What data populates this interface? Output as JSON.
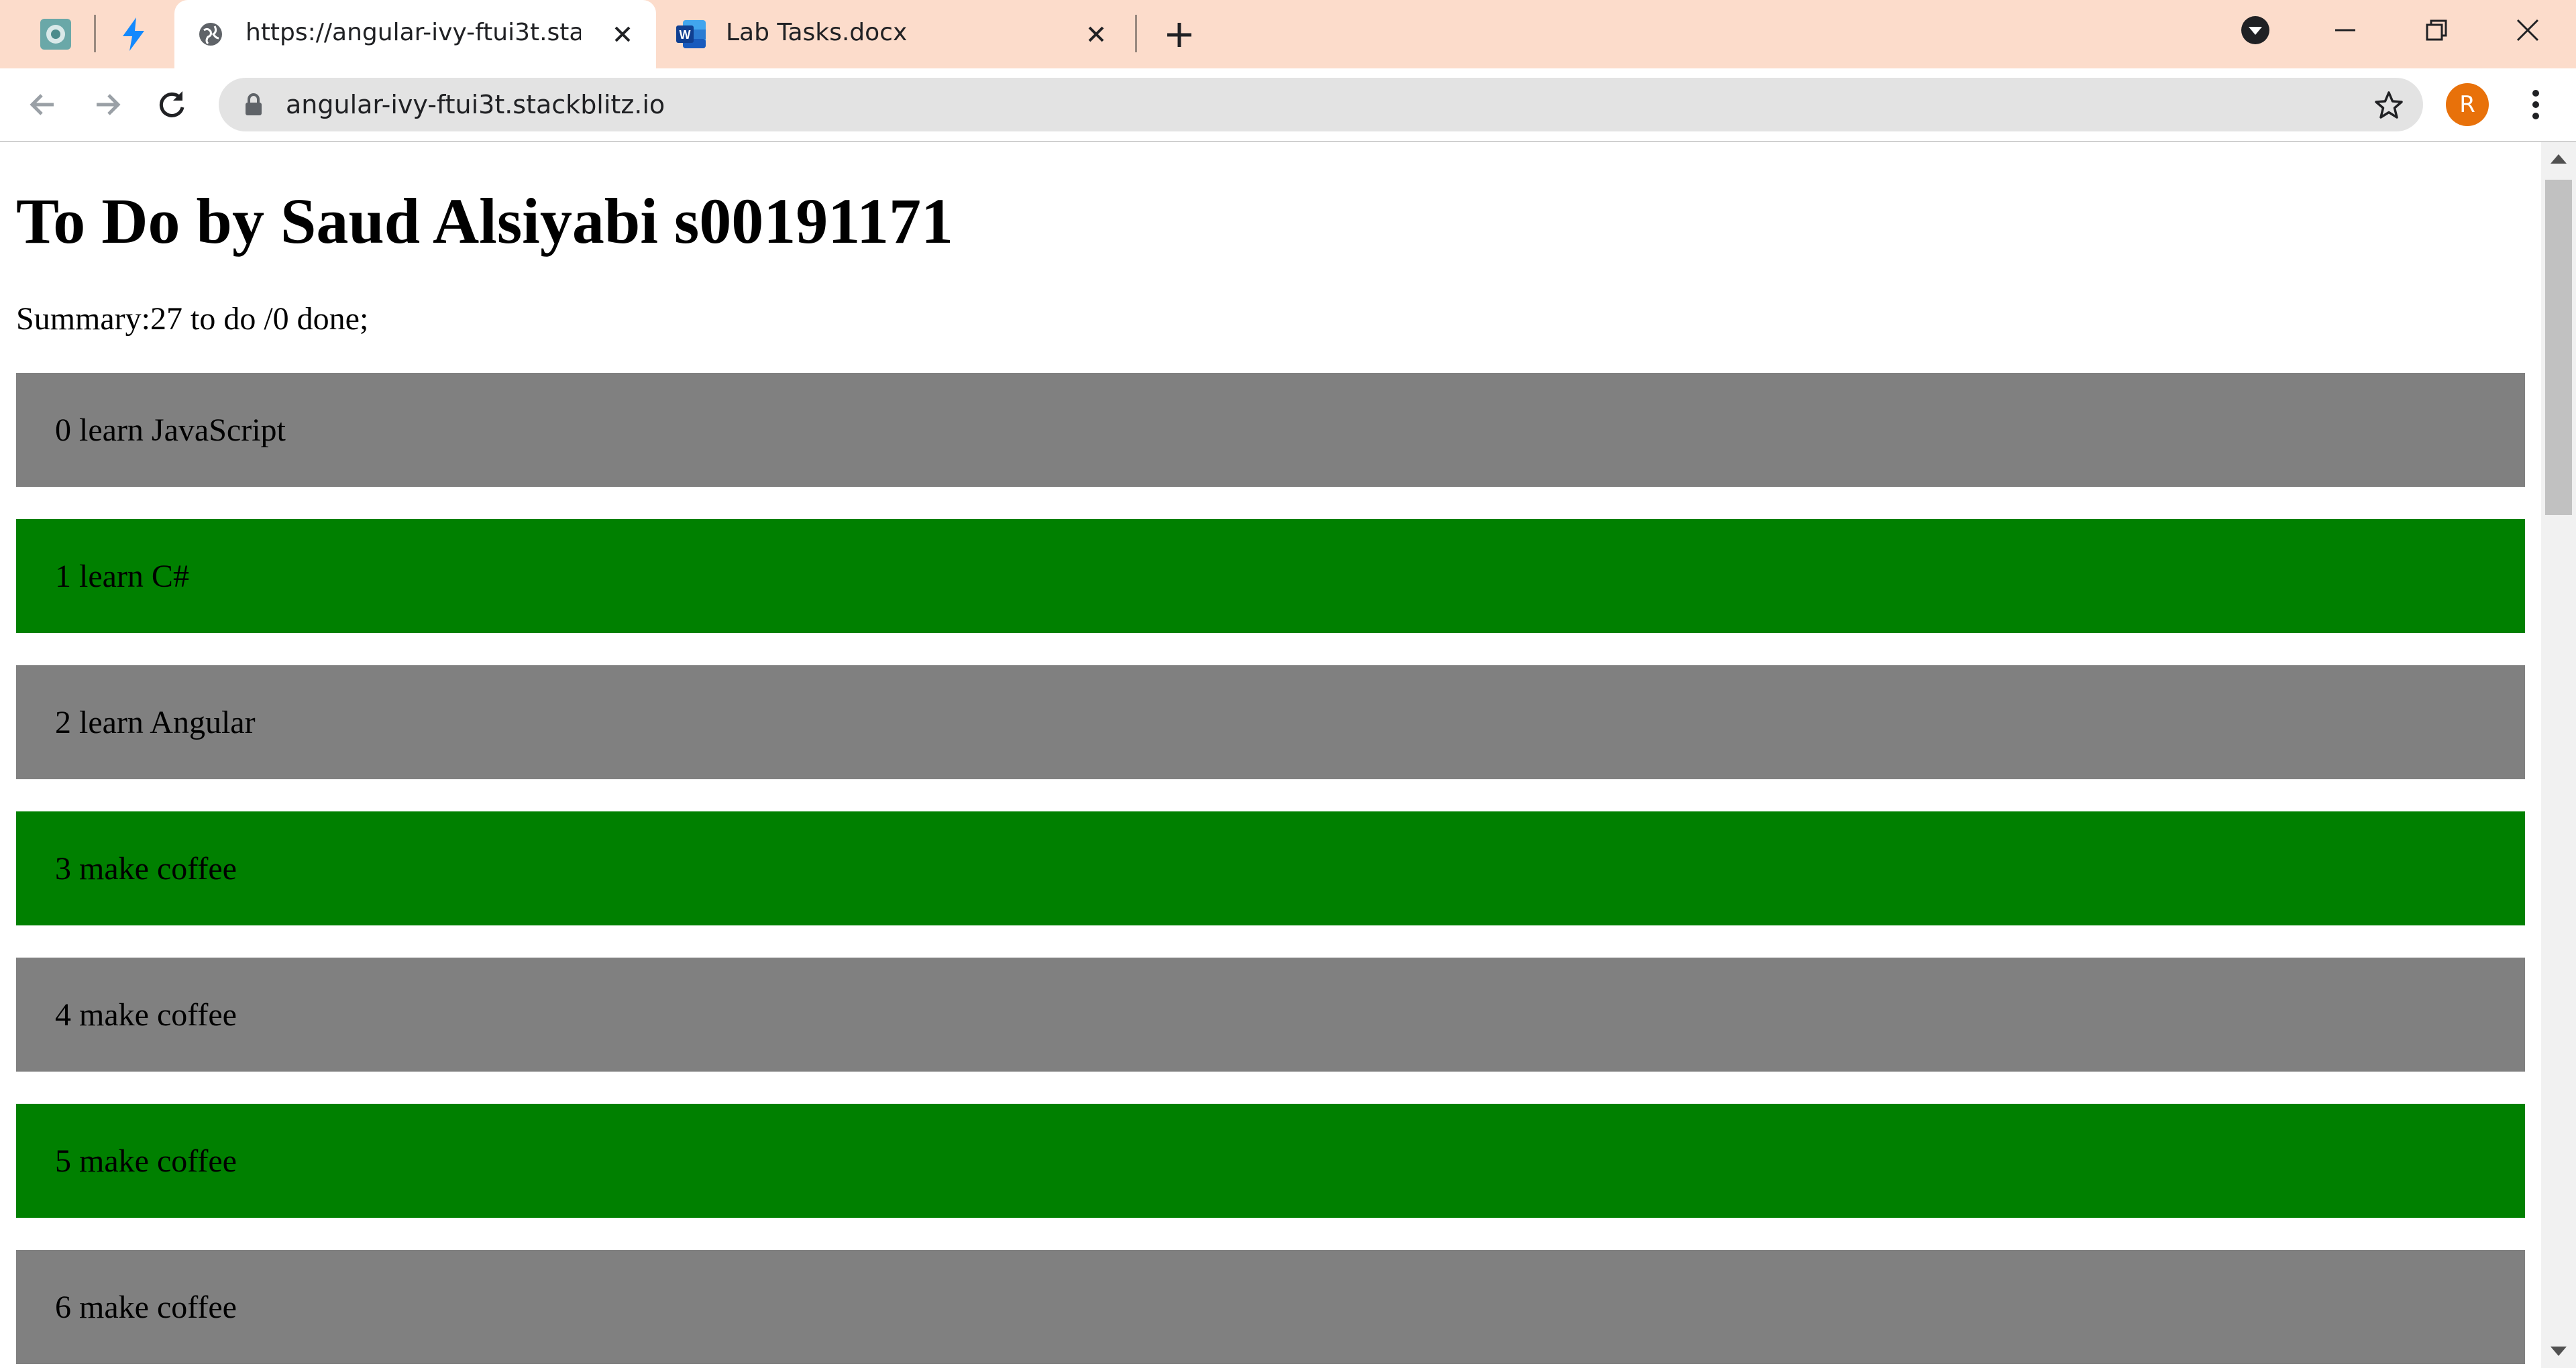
{
  "browser": {
    "tabs": [
      {
        "title": "https://angular-ivy-ftui3t.stackblitz.io",
        "active": true
      },
      {
        "title": "Lab Tasks.docx",
        "active": false
      }
    ],
    "address_bar": {
      "url": "angular-ivy-ftui3t.stackblitz.io"
    },
    "profile_initial": "R",
    "colors": {
      "tabstrip": "#fcdccb",
      "avatar": "#e8710a"
    }
  },
  "page": {
    "title": "To Do by Saud Alsiyabi s00191171",
    "summary": "Summary:27 to do /0 done;",
    "todos": [
      {
        "label": "0 learn JavaScript",
        "color": "gray"
      },
      {
        "label": "1 learn C#",
        "color": "green"
      },
      {
        "label": "2 learn Angular",
        "color": "gray"
      },
      {
        "label": "3 make coffee",
        "color": "green"
      },
      {
        "label": "4 make coffee",
        "color": "gray"
      },
      {
        "label": "5 make coffee",
        "color": "green"
      },
      {
        "label": "6 make coffee",
        "color": "gray"
      }
    ],
    "colors": {
      "gray": "#808080",
      "green": "#008000"
    }
  }
}
